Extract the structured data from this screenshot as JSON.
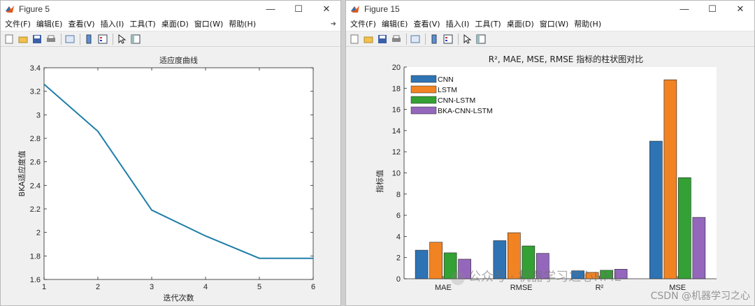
{
  "left": {
    "title": "Figure 5",
    "menu": [
      "文件(F)",
      "编辑(E)",
      "查看(V)",
      "插入(I)",
      "工具(T)",
      "桌面(D)",
      "窗口(W)",
      "帮助(H)"
    ],
    "chart_data": {
      "type": "line",
      "title": "适应度曲线",
      "xlabel": "迭代次数",
      "ylabel": "BKA适应度值",
      "x": [
        1,
        2,
        3,
        4,
        5,
        6
      ],
      "values": [
        3.26,
        2.86,
        2.19,
        1.97,
        1.78,
        1.78
      ],
      "xlim": [
        1,
        6
      ],
      "ylim": [
        1.6,
        3.4
      ],
      "xticks": [
        "1",
        "2",
        "3",
        "4",
        "5",
        "6"
      ],
      "yticks": [
        "1.6",
        "1.8",
        "2",
        "2.2",
        "2.4",
        "2.6",
        "2.8",
        "3",
        "3.2",
        "3.4"
      ],
      "color": "#1f7ea8",
      "grid": false
    }
  },
  "right": {
    "title": "Figure 15",
    "menu": [
      "文件(F)",
      "编辑(E)",
      "查看(V)",
      "插入(I)",
      "工具(T)",
      "桌面(D)",
      "窗口(W)",
      "帮助(H)"
    ],
    "chart_data": {
      "type": "bar",
      "title": "R², MAE, MSE, RMSE 指标的柱状图对比",
      "xlabel": "",
      "ylabel": "指标值",
      "categories": [
        "MAE",
        "RMSE",
        "R²",
        "MSE"
      ],
      "series": [
        {
          "name": "CNN",
          "color": "#2e74b5",
          "values": [
            2.7,
            3.6,
            0.75,
            13.0
          ]
        },
        {
          "name": "LSTM",
          "color": "#f28322",
          "values": [
            3.45,
            4.35,
            0.6,
            18.8
          ]
        },
        {
          "name": "CNN-LSTM",
          "color": "#33a133",
          "values": [
            2.45,
            3.1,
            0.8,
            9.55
          ]
        },
        {
          "name": "BKA-CNN-LSTM",
          "color": "#9467bd",
          "values": [
            1.85,
            2.4,
            0.9,
            5.8
          ]
        }
      ],
      "ylim": [
        0,
        20
      ],
      "yticks": [
        "0",
        "2",
        "4",
        "6",
        "8",
        "10",
        "12",
        "14",
        "16",
        "18",
        "20"
      ],
      "legend": "top-left",
      "grid": false
    },
    "watermark": [
      "公众号 · 机器学习之心HML",
      "CSDN @机器学习之心"
    ]
  }
}
